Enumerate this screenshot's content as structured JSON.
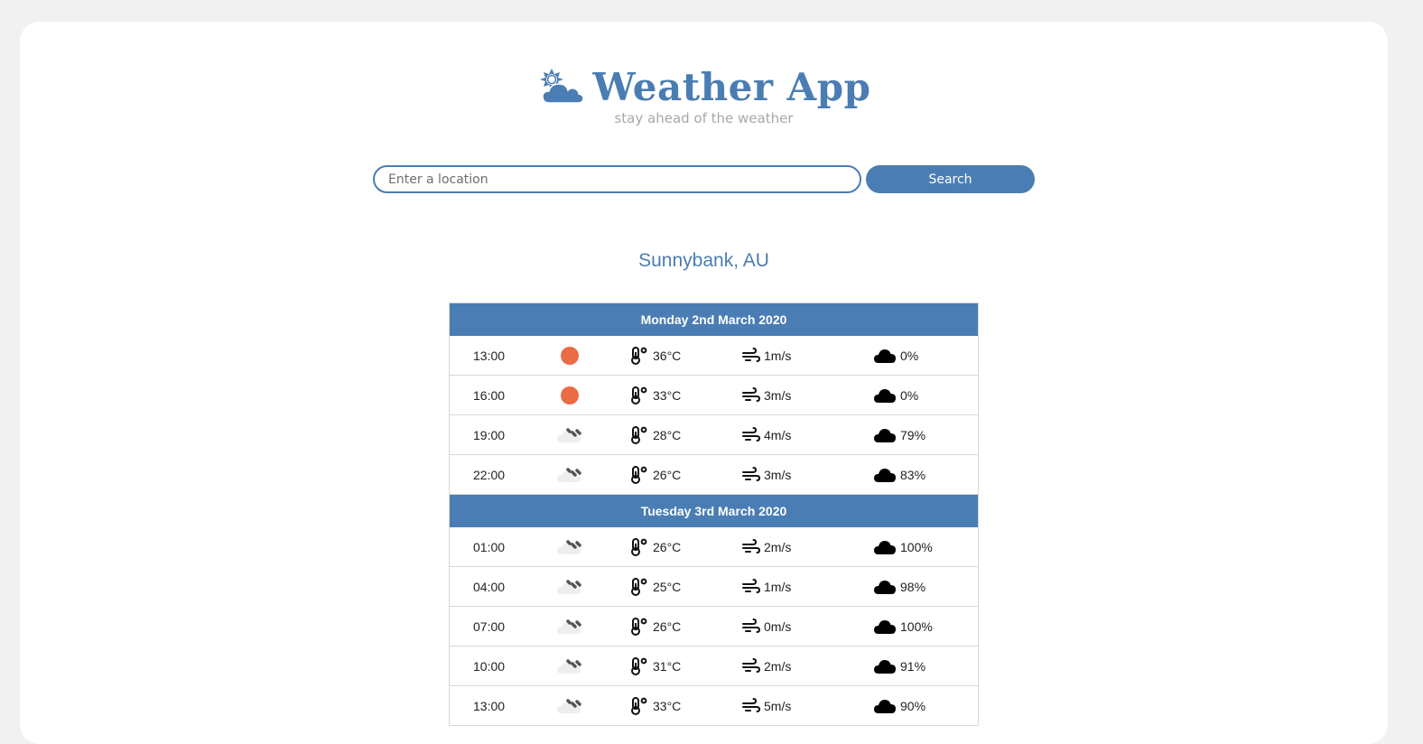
{
  "app": {
    "title": "Weather App",
    "tagline": "stay ahead of the weather",
    "logo_icon": "sun-cloud-icon",
    "accent_color": "#4a7db3"
  },
  "search": {
    "placeholder": "Enter a location",
    "value": "",
    "button_label": "Search"
  },
  "location": "Sunnybank, AU",
  "days": [
    {
      "label": "Monday 2nd March 2020",
      "rows": [
        {
          "time": "13:00",
          "condition": "sunny",
          "temp": "36°C",
          "wind": "1m/s",
          "cloud": "0%"
        },
        {
          "time": "16:00",
          "condition": "sunny",
          "temp": "33°C",
          "wind": "3m/s",
          "cloud": "0%"
        },
        {
          "time": "19:00",
          "condition": "rain",
          "temp": "28°C",
          "wind": "4m/s",
          "cloud": "79%"
        },
        {
          "time": "22:00",
          "condition": "rain",
          "temp": "26°C",
          "wind": "3m/s",
          "cloud": "83%"
        }
      ]
    },
    {
      "label": "Tuesday 3rd March 2020",
      "rows": [
        {
          "time": "01:00",
          "condition": "rain",
          "temp": "26°C",
          "wind": "2m/s",
          "cloud": "100%"
        },
        {
          "time": "04:00",
          "condition": "rain",
          "temp": "25°C",
          "wind": "1m/s",
          "cloud": "98%"
        },
        {
          "time": "07:00",
          "condition": "rain",
          "temp": "26°C",
          "wind": "0m/s",
          "cloud": "100%"
        },
        {
          "time": "10:00",
          "condition": "rain",
          "temp": "31°C",
          "wind": "2m/s",
          "cloud": "91%"
        },
        {
          "time": "13:00",
          "condition": "rain",
          "temp": "33°C",
          "wind": "5m/s",
          "cloud": "90%"
        }
      ]
    }
  ],
  "colors": {
    "sunny": "#ea6b45",
    "header_bg": "#4a7db3",
    "page_bg": "#f1f1f1"
  }
}
